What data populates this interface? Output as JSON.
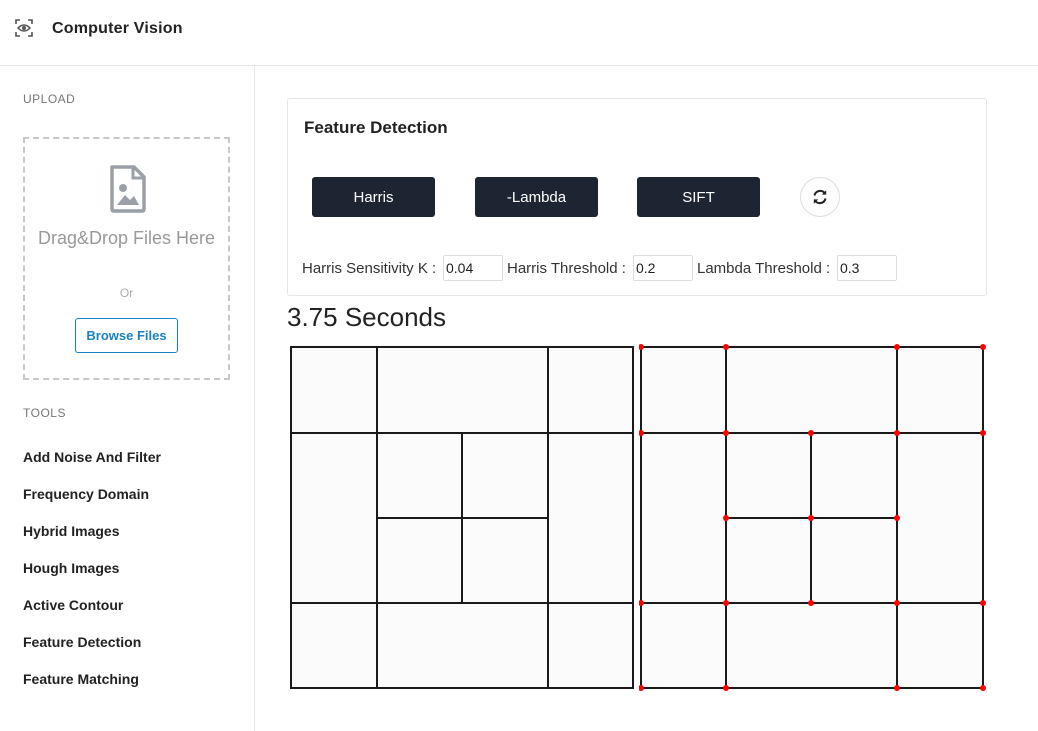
{
  "header": {
    "title": "Computer Vision",
    "logo_icon": "eye-scan-icon"
  },
  "sidebar": {
    "upload_label": "UPLOAD",
    "dropzone": {
      "icon": "image-file-icon",
      "text": "Drag&Drop Files Here",
      "or": "Or",
      "browse_label": "Browse Files"
    },
    "tools_label": "TOOLS",
    "tools": [
      {
        "label": "Add Noise And Filter"
      },
      {
        "label": "Frequency Domain"
      },
      {
        "label": "Hybrid Images"
      },
      {
        "label": "Hough Images"
      },
      {
        "label": "Active Contour"
      },
      {
        "label": "Feature Detection"
      },
      {
        "label": "Feature Matching"
      }
    ]
  },
  "feature_card": {
    "title": "Feature Detection",
    "buttons": [
      {
        "label": "Harris"
      },
      {
        "label": "-Lambda"
      },
      {
        "label": "SIFT"
      }
    ],
    "refresh_icon": "refresh-icon",
    "params": [
      {
        "label": "Harris Sensitivity K :",
        "value": "0.04"
      },
      {
        "label": "Harris Threshold :",
        "value": "0.2"
      },
      {
        "label": "Lambda Threshold :",
        "value": "0.3"
      }
    ]
  },
  "result": {
    "time": "3.75 Seconds",
    "original_image": "grid-rectangles-image",
    "output_image": "grid-rectangles-with-corner-points-image",
    "corner_color": "#ff0000"
  },
  "colors": {
    "accent": "#1a82c4",
    "button_dark": "#1e2532"
  }
}
